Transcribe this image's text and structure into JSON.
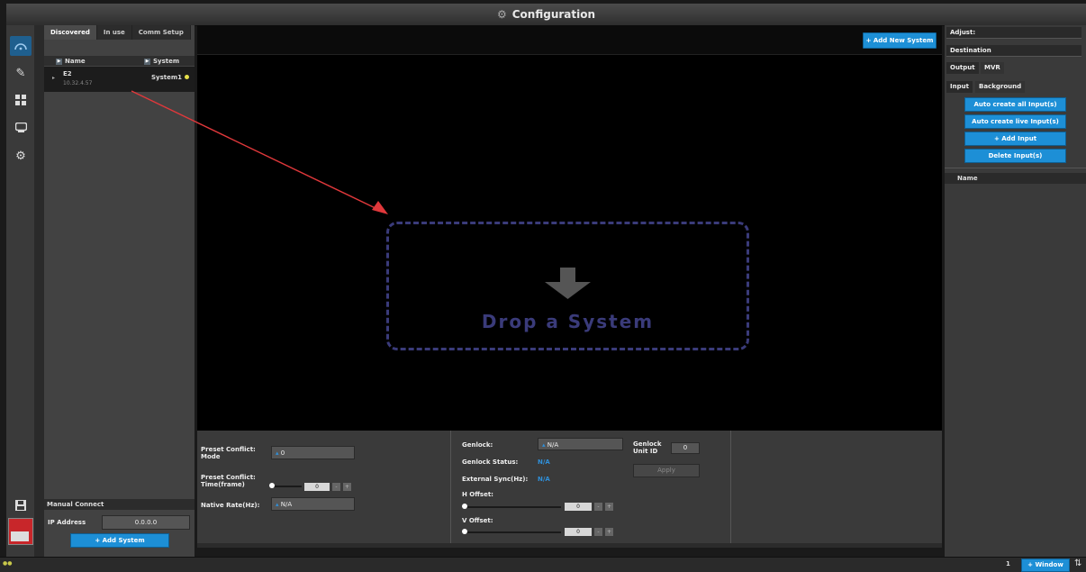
{
  "window": {
    "title": "Configuration",
    "title_icon": "network-icon"
  },
  "nav": {
    "items": [
      "systems-icon",
      "edit-icon",
      "layout-icon",
      "display-icon",
      "settings-icon"
    ]
  },
  "left_panel": {
    "tabs": [
      "Discovered",
      "In use",
      "Comm Setup"
    ],
    "columns": {
      "name": "Name",
      "system": "System"
    },
    "device": {
      "name": "E2",
      "ip": "10.32.4.57",
      "system": "System1"
    },
    "manual_connect": {
      "header": "Manual Connect",
      "ip_label": "IP Address",
      "ip_value": "0.0.0.0",
      "add_button": "+ Add System"
    }
  },
  "main": {
    "add_new_button": "+ Add New System",
    "drop_text": "Drop a System"
  },
  "settings": {
    "preset_conflict_mode_label": "Preset Conflict: Mode",
    "preset_conflict_mode_value": "0",
    "preset_conflict_time_label": "Preset Conflict: Time(frame)",
    "preset_conflict_time_value": "0",
    "native_rate_label": "Native Rate(Hz):",
    "native_rate_value": "N/A",
    "genlock_label": "Genlock:",
    "genlock_value": "N/A",
    "genlock_status_label": "Genlock Status:",
    "genlock_status_value": "N/A",
    "external_sync_label": "External Sync(Hz):",
    "external_sync_value": "N/A",
    "genlock_unit_label": "Genlock Unit ID",
    "genlock_unit_value": "0",
    "apply_button": "Apply",
    "h_offset_label": "H Offset:",
    "h_offset_value": "0",
    "v_offset_label": "V Offset:",
    "v_offset_value": "0"
  },
  "right_panel": {
    "adjust_tab": "Adjust:",
    "destination_tab": "Destination",
    "output_tabs": [
      "Output",
      "MVR"
    ],
    "input_tabs": [
      "Input",
      "Background"
    ],
    "buttons": [
      "Auto create all Input(s)",
      "Auto create live Input(s)",
      "+ Add Input",
      "Delete Input(s)"
    ],
    "name_header": "Name"
  },
  "statusbar": {
    "page": "1",
    "window_button": "+ Window"
  },
  "colors": {
    "accent": "#1d8fd6",
    "arrow": "#e0383b",
    "drop_border": "#3a3b7a"
  }
}
